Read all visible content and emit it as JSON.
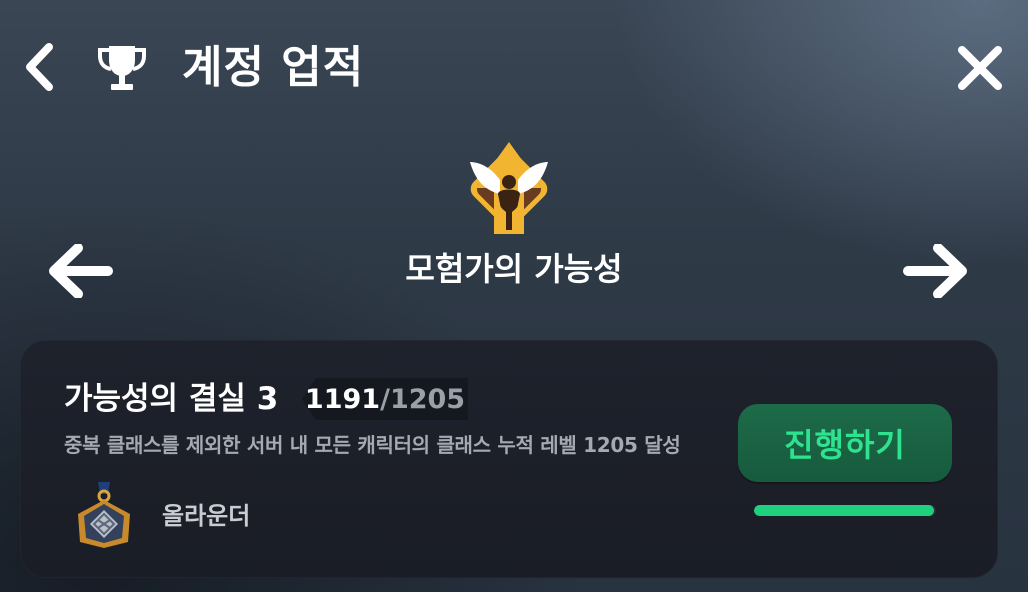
{
  "header": {
    "title": "계정 업적",
    "back_icon": "chevron-left-icon",
    "trophy_icon": "trophy-icon",
    "close_icon": "close-icon"
  },
  "category": {
    "name": "모험가의 가능성",
    "icon": "winged-figure-emblem-icon",
    "prev_icon": "arrow-left-icon",
    "next_icon": "arrow-right-icon"
  },
  "achievement": {
    "title": "가능성의 결실 3",
    "progress_current": "1191",
    "progress_separator": "/",
    "progress_total": "1205",
    "progress_fraction": 0.988,
    "description": "중복 클래스를 제외한 서버 내 모든 캐릭터의 클래스 누적 레벨 1205 달성",
    "reward_name": "올라운더",
    "reward_icon": "medal-icon",
    "go_button_label": "진행하기"
  },
  "colors": {
    "accent_green": "#2ee38f",
    "progress_fill": "#1fd07f",
    "button_bg": "#1d6b49",
    "emblem_gold": "#f2b531",
    "emblem_brown": "#6a3c1f"
  }
}
